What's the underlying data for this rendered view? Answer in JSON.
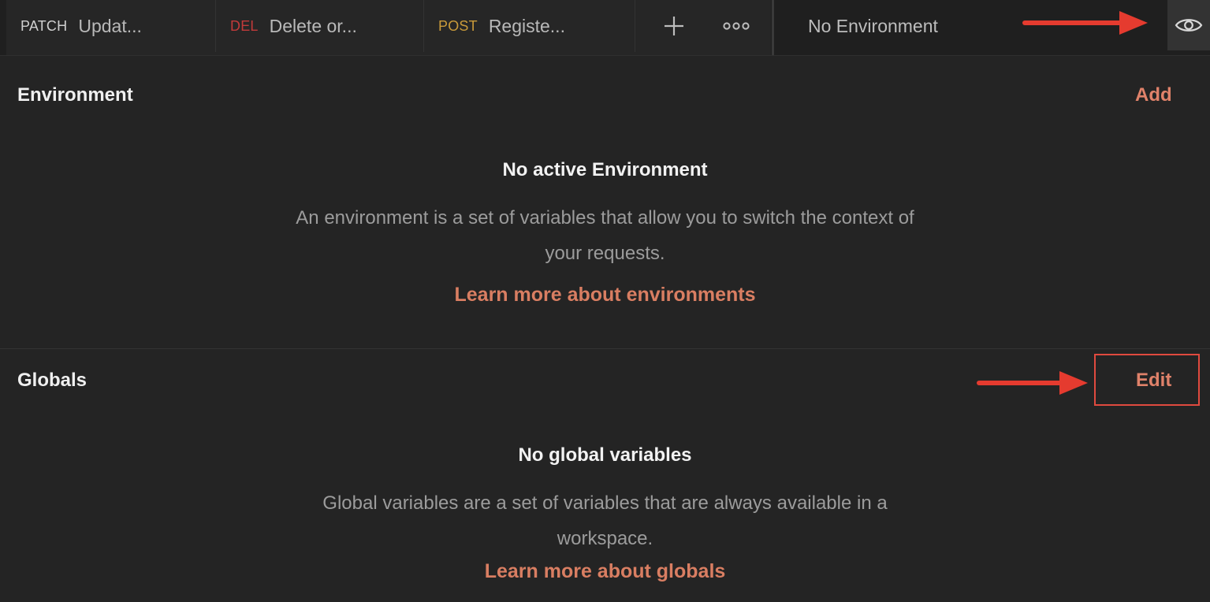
{
  "tabs": [
    {
      "method": "PATCH",
      "title": "Updat...",
      "method_color": "#cfcfcf"
    },
    {
      "method": "DEL",
      "title": "Delete or...",
      "method_color": "#c23a3a"
    },
    {
      "method": "POST",
      "title": "Registe...",
      "method_color": "#c99a3a"
    }
  ],
  "toolbar": {
    "new_tab_icon": "plus-icon",
    "more_icon": "ellipsis-icon",
    "environment_label": "No Environment",
    "quick_look_icon": "eye-icon"
  },
  "environment_section": {
    "heading": "Environment",
    "add_label": "Add",
    "empty_title": "No active Environment",
    "empty_description": "An environment is a set of variables that allow you to switch the context of your requests.",
    "learn_more": "Learn more about environments"
  },
  "globals_section": {
    "heading": "Globals",
    "edit_label": "Edit",
    "empty_title": "No global variables",
    "empty_description": "Global variables are a set of variables that are always available in a workspace.",
    "learn_more": "Learn more about globals"
  },
  "colors": {
    "background": "#242424",
    "accent": "#e0826a",
    "annotation": "#e04a3f"
  }
}
